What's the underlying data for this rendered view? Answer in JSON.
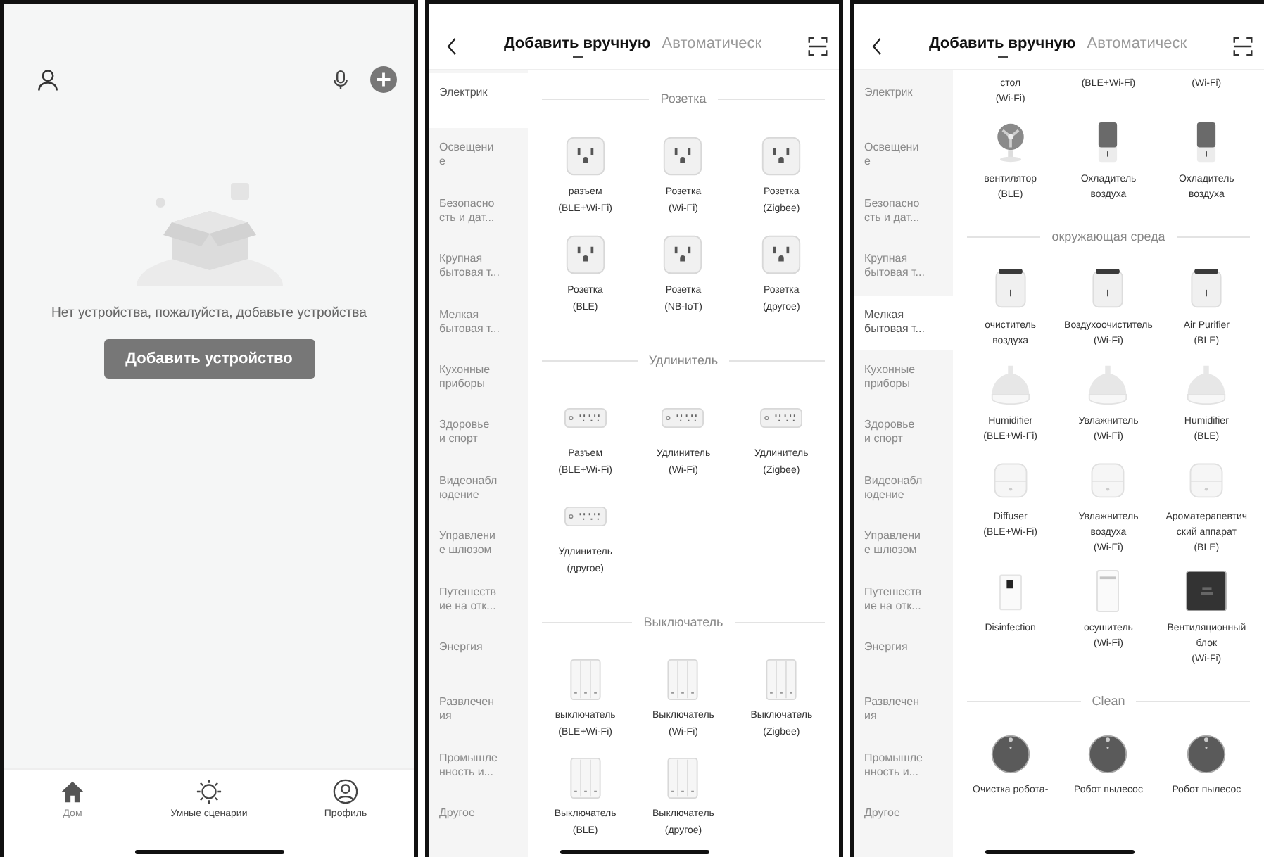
{
  "home_screen": {
    "empty_message": "Нет устройства, пожалуйста, добавьте устройства",
    "add_button": "Добавить устройство",
    "nav": [
      {
        "kind": "home",
        "label": "Дом",
        "selected": true
      },
      {
        "kind": "scenes",
        "label": "Умные сценарии",
        "selected": false
      },
      {
        "kind": "profile",
        "label": "Профиль",
        "selected": false
      }
    ]
  },
  "add_screens": [
    {
      "tabs": [
        {
          "label": "Добавить вручную",
          "selected": true
        },
        {
          "label": "Автоматическ",
          "selected": false
        }
      ],
      "sidebar": [
        {
          "label": "Электрик",
          "selected": true
        },
        {
          "label": "Освещени\nе",
          "selected": false
        },
        {
          "label": "Безопасно\nсть и дат...",
          "selected": false
        },
        {
          "label": "Крупная\nбытовая т...",
          "selected": false
        },
        {
          "label": "Мелкая\nбытовая т...",
          "selected": false
        },
        {
          "label": "Кухонные\nприборы",
          "selected": false
        },
        {
          "label": "Здоровье\nи спорт",
          "selected": false
        },
        {
          "label": "Видеонабл\nюдение",
          "selected": false
        },
        {
          "label": "Управлени\nе шлюзом",
          "selected": false
        },
        {
          "label": "Путешеств\nие на отк...",
          "selected": false
        },
        {
          "label": "Энергия",
          "selected": false
        },
        {
          "label": "Развлечен\nия",
          "selected": false
        },
        {
          "label": "Промышле\nнность  и...",
          "selected": false
        },
        {
          "label": "Другое",
          "selected": false
        }
      ],
      "sections": [
        {
          "title": "Розетка",
          "items": [
            {
              "kind": "socket",
              "label": "разъем\n(BLE+Wi-Fi)"
            },
            {
              "kind": "socket",
              "label": "Розетка\n(Wi-Fi)"
            },
            {
              "kind": "socket",
              "label": "Розетка\n(Zigbee)"
            },
            {
              "kind": "socket",
              "label": "Розетка\n(BLE)"
            },
            {
              "kind": "socket",
              "label": "Розетка\n(NB-IoT)"
            },
            {
              "kind": "socket",
              "label": "Розетка\n(другое)"
            }
          ]
        },
        {
          "title": "Удлинитель",
          "items": [
            {
              "kind": "strip",
              "label": "Разъем\n(BLE+Wi-Fi)"
            },
            {
              "kind": "strip",
              "label": "Удлинитель\n(Wi-Fi)"
            },
            {
              "kind": "strip",
              "label": "Удлинитель\n(Zigbee)"
            },
            {
              "kind": "strip",
              "label": "Удлинитель\n(другое)"
            }
          ]
        },
        {
          "title": "Выключатель",
          "items": [
            {
              "kind": "switch",
              "label": "выключатель\n(BLE+Wi-Fi)"
            },
            {
              "kind": "switch",
              "label": "Выключатель\n(Wi-Fi)"
            },
            {
              "kind": "switch",
              "label": "Выключатель\n(Zigbee)"
            },
            {
              "kind": "switch",
              "label": "Выключатель\n(BLE)"
            },
            {
              "kind": "switch",
              "label": "Выключатель\n(другое)"
            }
          ]
        }
      ]
    },
    {
      "tabs": [
        {
          "label": "Добавить вручную",
          "selected": true
        },
        {
          "label": "Автоматическ",
          "selected": false
        }
      ],
      "sidebar": [
        {
          "label": "Электрик",
          "selected": false
        },
        {
          "label": "Освещени\nе",
          "selected": false
        },
        {
          "label": "Безопасно\nсть и дат...",
          "selected": false
        },
        {
          "label": "Крупная\nбытовая т...",
          "selected": false
        },
        {
          "label": "Мелкая\nбытовая т...",
          "selected": true
        },
        {
          "label": "Кухонные\nприборы",
          "selected": false
        },
        {
          "label": "Здоровье\nи спорт",
          "selected": false
        },
        {
          "label": "Видеонабл\nюдение",
          "selected": false
        },
        {
          "label": "Управлени\nе шлюзом",
          "selected": false
        },
        {
          "label": "Путешеств\nие на отк...",
          "selected": false
        },
        {
          "label": "Энергия",
          "selected": false
        },
        {
          "label": "Развлечен\nия",
          "selected": false
        },
        {
          "label": "Промышле\nнность  и...",
          "selected": false
        },
        {
          "label": "Другое",
          "selected": false
        }
      ],
      "sections": [
        {
          "items": [
            {
              "kind": "clipped",
              "label": "стол\n(Wi-Fi)"
            },
            {
              "kind": "clipped",
              "label": "(BLE+Wi-Fi)"
            },
            {
              "kind": "clipped",
              "label": "(Wi-Fi)"
            },
            {
              "kind": "fan",
              "label": "вентилятор\n(BLE)"
            },
            {
              "kind": "cooler",
              "label": "Охладитель\nвоздуха"
            },
            {
              "kind": "cooler",
              "label": "Охладитель\nвоздуха"
            }
          ]
        },
        {
          "title": "окружающая среда",
          "items": [
            {
              "kind": "purifier",
              "label": "очиститель\nвоздуха"
            },
            {
              "kind": "purifier",
              "label": "Воздухоочиститель\n(Wi-Fi)"
            },
            {
              "kind": "purifier",
              "label": "Air Purifier\n(BLE)"
            },
            {
              "kind": "humidifier",
              "label": "Humidifier\n(BLE+Wi-Fi)"
            },
            {
              "kind": "humidifier",
              "label": "Увлажнитель\n(Wi-Fi)"
            },
            {
              "kind": "humidifier",
              "label": "Humidifier\n(BLE)"
            },
            {
              "kind": "diffuser",
              "label": "Diffuser\n(BLE+Wi-Fi)"
            },
            {
              "kind": "diffuser",
              "label": "Увлажнитель\nвоздуха\n(Wi-Fi)"
            },
            {
              "kind": "diffuser",
              "label": "Ароматерапевтич\nский аппарат\n(BLE)"
            },
            {
              "kind": "disinfection",
              "label": "Disinfection"
            },
            {
              "kind": "dehumidifier",
              "label": "осушитель\n(Wi-Fi)"
            },
            {
              "kind": "ventilation",
              "label": "Вентиляционный\nблок\n(Wi-Fi)"
            }
          ]
        },
        {
          "title": "Clean",
          "items": [
            {
              "kind": "robot",
              "label": "Очистка робота-"
            },
            {
              "kind": "robot",
              "label": "Робот пылесос"
            },
            {
              "kind": "robot",
              "label": "Робот пылесос"
            }
          ]
        }
      ]
    }
  ]
}
